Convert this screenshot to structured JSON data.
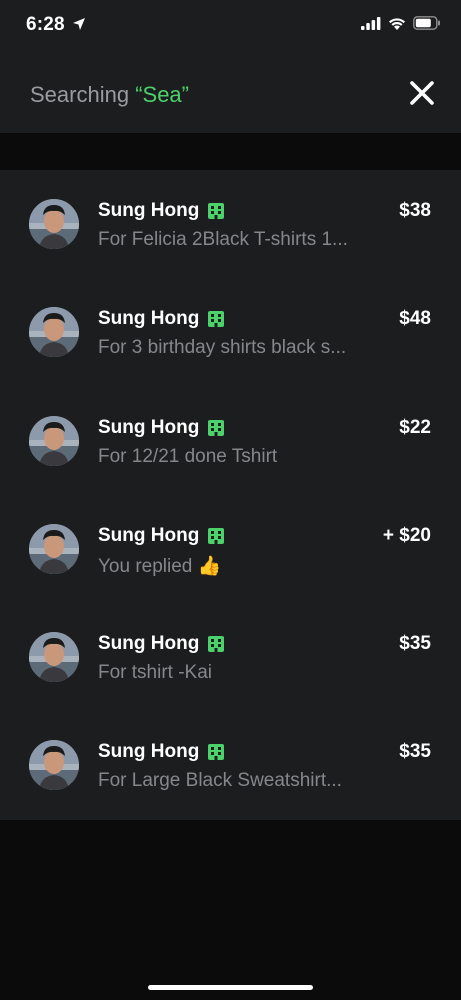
{
  "status_bar": {
    "time": "6:28"
  },
  "header": {
    "search_prefix": "Searching ",
    "search_query": "“Sea”"
  },
  "transactions": [
    {
      "name": "Sung Hong",
      "amount": "$38",
      "note": "For Felicia 2Black T-shirts 1..."
    },
    {
      "name": "Sung Hong",
      "amount": "$48",
      "note": "For 3 birthday shirts black s..."
    },
    {
      "name": "Sung Hong",
      "amount": "$22",
      "note": "For 12/21 done Tshirt"
    },
    {
      "name": "Sung Hong",
      "amount": "+ $20",
      "note": "You replied 👍"
    },
    {
      "name": "Sung Hong",
      "amount": "$35",
      "note": "For tshirt -Kai"
    },
    {
      "name": "Sung Hong",
      "amount": "$35",
      "note": "For Large Black Sweatshirt..."
    }
  ],
  "colors": {
    "accent_green": "#4cd16b",
    "background": "#0b0b0c",
    "surface": "#1c1d1f"
  },
  "icons": [
    "location-arrow-icon",
    "signal-icon",
    "wifi-icon",
    "battery-icon",
    "close-icon",
    "business-icon"
  ]
}
